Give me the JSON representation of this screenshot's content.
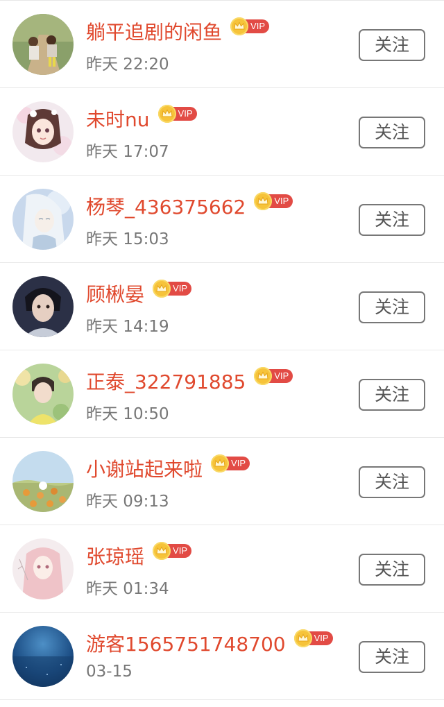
{
  "users": [
    {
      "name": "躺平追剧的闲鱼",
      "badge": "VIP",
      "time": "昨天 22:20",
      "follow_label": "关注",
      "avatar": "avatar-kids-on-path"
    },
    {
      "name": "未时nu",
      "badge": "VIP",
      "time": "昨天 17:07",
      "follow_label": "关注",
      "avatar": "avatar-anime-girl-flowers"
    },
    {
      "name": "杨琴_436375662",
      "badge": "VIP",
      "time": "昨天 15:03",
      "follow_label": "关注",
      "avatar": "avatar-white-hair-anime"
    },
    {
      "name": "顾楸晏",
      "badge": "VIP",
      "time": "昨天 14:19",
      "follow_label": "关注",
      "avatar": "avatar-male-portrait"
    },
    {
      "name": "正泰_322791885",
      "badge": "VIP",
      "time": "昨天 10:50",
      "follow_label": "关注",
      "avatar": "avatar-boy-in-garden"
    },
    {
      "name": "小谢站起来啦",
      "badge": "VIP",
      "time": "昨天 09:13",
      "follow_label": "关注",
      "avatar": "avatar-cartoon-field"
    },
    {
      "name": "张琼瑶",
      "badge": "VIP",
      "time": "昨天 01:34",
      "follow_label": "关注",
      "avatar": "avatar-pink-anime-girl"
    },
    {
      "name": "游客1565751748700",
      "badge": "VIP",
      "time": "03-15",
      "follow_label": "关注",
      "avatar": "avatar-blue-ocean"
    }
  ],
  "colors": {
    "name": "#e0492e",
    "time": "#777777",
    "vip_pill": "#e24b45",
    "crown": "#f6c33a",
    "button_border": "#777777"
  }
}
